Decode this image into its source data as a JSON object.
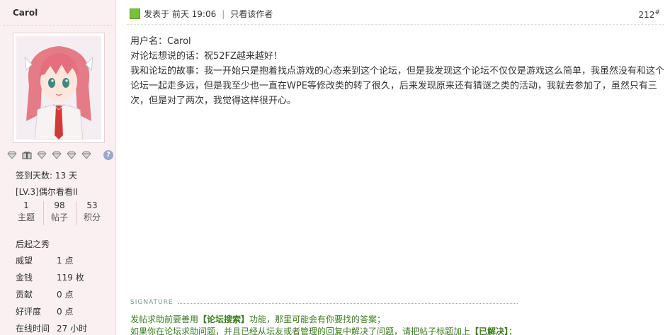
{
  "sidebar": {
    "username": "Carol",
    "medal_icons": [
      "diamond-medal-icon",
      "gift-medal-icon",
      "diamond-medal-icon",
      "diamond-medal-icon",
      "diamond-medal-icon",
      "diamond-medal-icon"
    ],
    "help_badge": "?",
    "signin_days": "签到天数: 13 天",
    "level": "[LV.3]偶尔看看II",
    "stats": [
      {
        "value": "1",
        "label": "主题"
      },
      {
        "value": "98",
        "label": "帖子"
      },
      {
        "value": "53",
        "label": "积分"
      }
    ],
    "rank": "后起之秀",
    "profile": [
      {
        "key": "威望",
        "value": "1 点"
      },
      {
        "key": "金钱",
        "value": "119 枚"
      },
      {
        "key": "贡献",
        "value": "0 点"
      },
      {
        "key": "好评度",
        "value": "0 点"
      },
      {
        "key": "在线时间",
        "value": "27 小时"
      }
    ]
  },
  "post": {
    "posted_at": "发表于 前天 19:06",
    "pipe": "|",
    "only_author": "只看该作者",
    "floor_number": "212",
    "floor_mark": "#",
    "content": [
      "用户名：Carol",
      "对论坛想说的话：祝52FZ越来越好！",
      "我和论坛的故事：我一开始只是抱着找点游戏的心态来到这个论坛，但是我发现这个论坛不仅仅是游戏这么简单，我虽然没有和这个论坛一起走多远，但是我至少也一直在WPE等修改类的转了很久，后来发现原来还有猜谜之类的活动，我就去参加了，虽然只有三次，但是对了两次，我觉得这样很开心。"
    ]
  },
  "signature": {
    "label": "SIGNATURE",
    "line1_a": "发帖求助前要善用",
    "line1_b": "【论坛搜索】",
    "line1_c": "功能，那里可能会有你要找的答案；",
    "line2_a": "如果你在论坛求助问题，并且已经从坛友或者管理的回复中解决了问题，请把帖子标题加上",
    "line2_b": "【已解决】",
    "line2_c": "；"
  },
  "colors": {
    "sidebar_bg": "#fbf0f1",
    "signature_green": "#3c7a20",
    "online_icon": "#7cbf3a"
  }
}
